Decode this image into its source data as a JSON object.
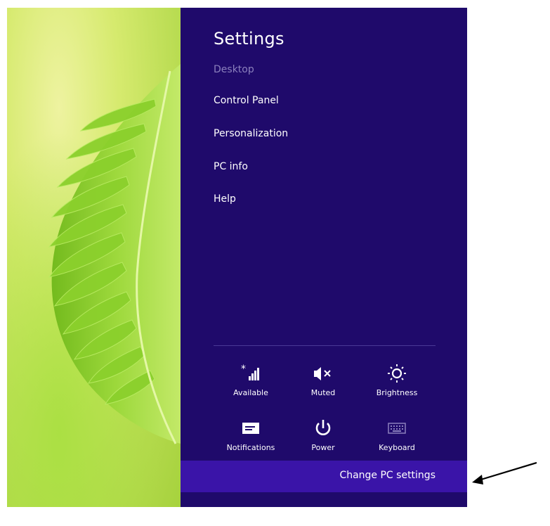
{
  "charm": {
    "title": "Settings",
    "items": [
      {
        "label": "Desktop"
      },
      {
        "label": "Control Panel"
      },
      {
        "label": "Personalization"
      },
      {
        "label": "PC info"
      },
      {
        "label": "Help"
      }
    ],
    "quick_settings": [
      {
        "label": "Available",
        "icon": "network-signal-icon"
      },
      {
        "label": "Muted",
        "icon": "speaker-muted-icon"
      },
      {
        "label": "Brightness",
        "icon": "brightness-sun-icon"
      },
      {
        "label": "Notifications",
        "icon": "notifications-icon"
      },
      {
        "label": "Power",
        "icon": "power-icon"
      },
      {
        "label": "Keyboard",
        "icon": "keyboard-icon"
      }
    ],
    "change_pc_settings": "Change PC settings"
  },
  "colors": {
    "charm_background": "#1f0a6b",
    "highlight_bar": "#3a14a8",
    "dim_text": "#8b80bd",
    "wallpaper_leaf": "#8fcf2a"
  }
}
